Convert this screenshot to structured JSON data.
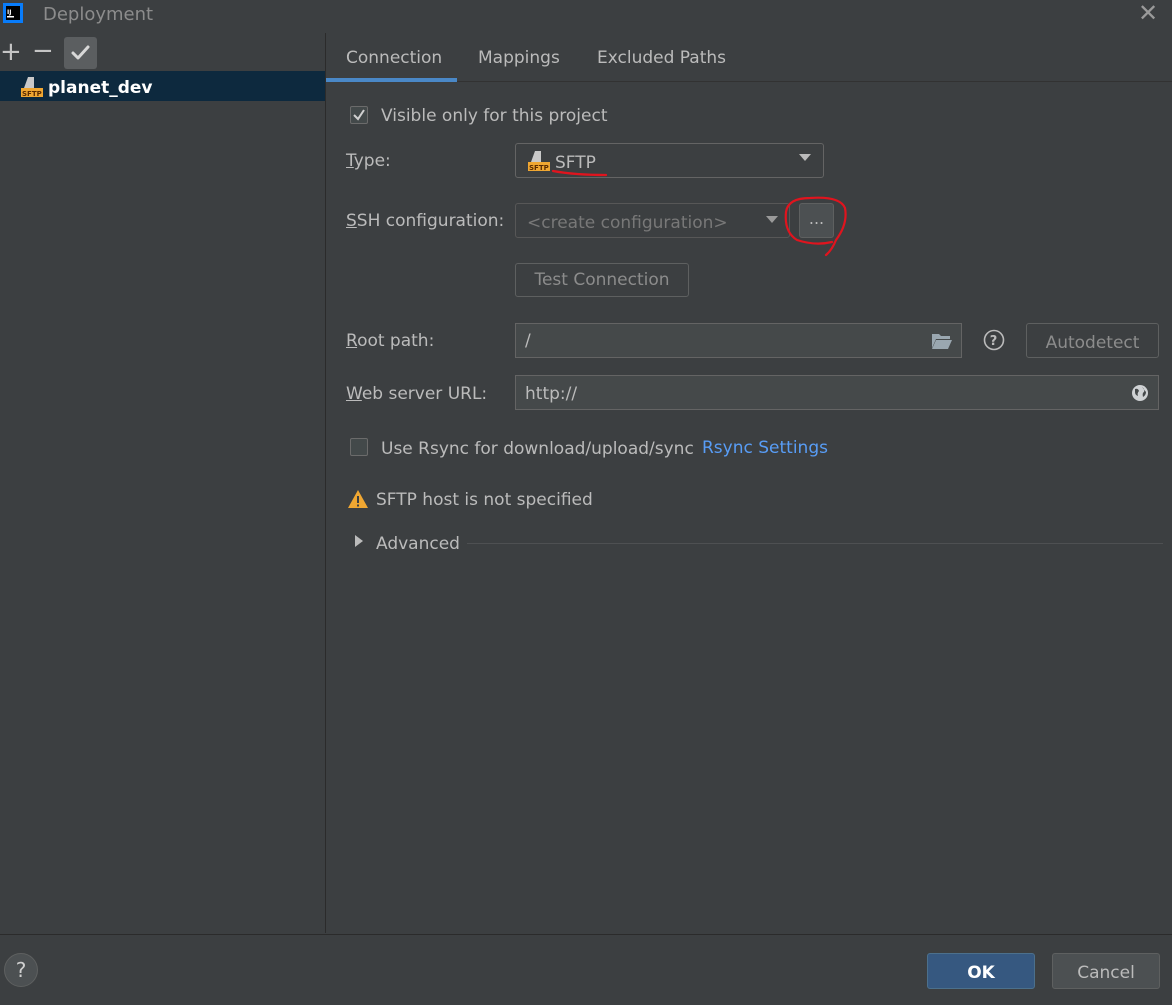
{
  "window": {
    "title": "Deployment",
    "close_glyph": "✕"
  },
  "toolbar": {
    "add_glyph": "+",
    "remove_glyph": "−"
  },
  "servers": [
    {
      "name": "planet_dev",
      "icon": "sftp-icon"
    }
  ],
  "tabs": [
    {
      "label": "Connection",
      "active": true
    },
    {
      "label": "Mappings",
      "active": false
    },
    {
      "label": "Excluded Paths",
      "active": false
    }
  ],
  "form": {
    "visible_only": {
      "label": "Visible only for this project",
      "checked": true
    },
    "type": {
      "label_first": "T",
      "label_rest": "ype:",
      "value": "SFTP"
    },
    "ssh": {
      "label_first": "S",
      "label_rest": "SH configuration:",
      "placeholder": "<create configuration>",
      "browse_label": "..."
    },
    "test_connection": "Test Connection",
    "root_path": {
      "label_first": "R",
      "label_rest": "oot path:",
      "value": "/",
      "autodetect": "Autodetect"
    },
    "web_url": {
      "label_first": "W",
      "label_rest": "eb server URL:",
      "value": "http://"
    },
    "rsync": {
      "label": "Use Rsync for download/upload/sync",
      "checked": false,
      "link": "Rsync Settings"
    },
    "warning": "SFTP host is not specified",
    "advanced": "Advanced"
  },
  "footer": {
    "help_glyph": "?",
    "ok": "OK",
    "cancel": "Cancel"
  },
  "colors": {
    "background": "#3c3f41",
    "accent": "#4a88c7",
    "link": "#589df6",
    "selection": "#0d293e",
    "primary_button": "#365880",
    "warning": "#f0a732",
    "annotation": "#e0141e"
  }
}
